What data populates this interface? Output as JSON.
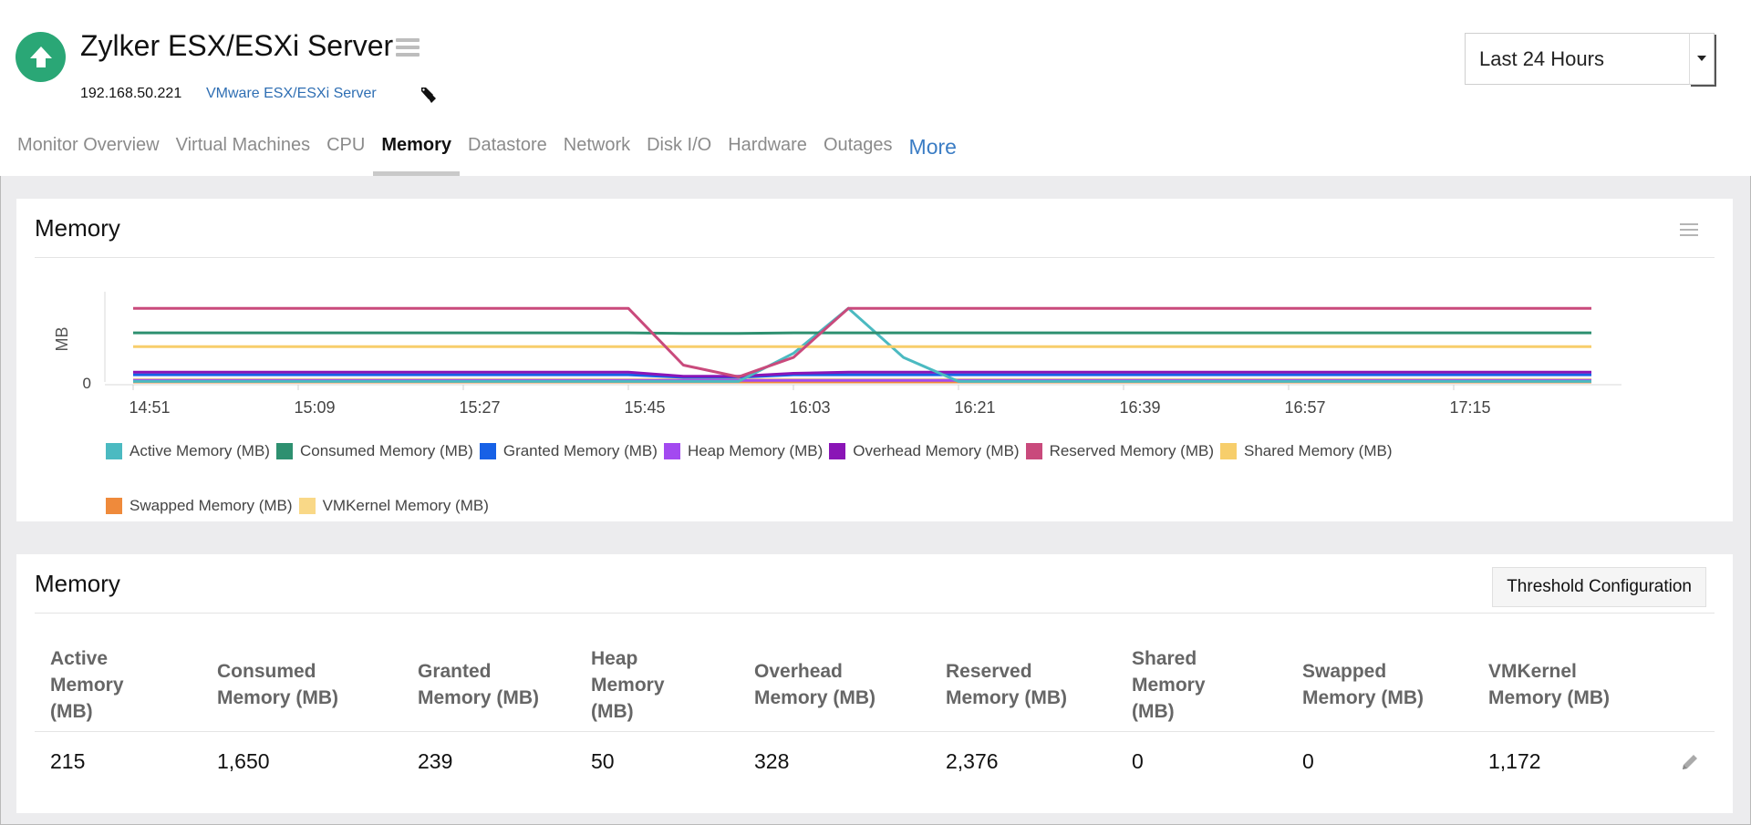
{
  "monitor": {
    "title": "Zylker ESX/ESXi Server",
    "ip": "192.168.50.221",
    "type_link": "VMware ESX/ESXi Server",
    "status_color": "#2aa776"
  },
  "time_range": {
    "selected": "Last 24 Hours"
  },
  "tabs": [
    {
      "label": "Monitor Overview"
    },
    {
      "label": "Virtual Machines"
    },
    {
      "label": "CPU"
    },
    {
      "label": "Memory"
    },
    {
      "label": "Datastore"
    },
    {
      "label": "Network"
    },
    {
      "label": "Disk I/O"
    },
    {
      "label": "Hardware"
    },
    {
      "label": "Outages"
    },
    {
      "label": "More"
    }
  ],
  "active_tab": "Memory",
  "chart_panel": {
    "title": "Memory"
  },
  "chart_data": {
    "type": "line",
    "title": "",
    "xlabel": "",
    "ylabel": "MB",
    "y_tick_labels": [
      "0"
    ],
    "x_tick_labels": [
      "14:51",
      "15:09",
      "15:27",
      "15:45",
      "16:03",
      "16:21",
      "16:39",
      "16:57",
      "17:15"
    ],
    "grid": false,
    "legend_position": "bottom",
    "x": [
      "14:51",
      "15:45",
      "15:51",
      "15:57",
      "16:03",
      "16:09",
      "16:15",
      "16:21",
      "17:35"
    ],
    "ylim": [
      0,
      900
    ],
    "series": [
      {
        "name": "Active Memory (MB)",
        "color": "#4bbac1",
        "values": [
          5,
          5,
          5,
          5,
          280,
          720,
          240,
          5,
          5
        ]
      },
      {
        "name": "Consumed Memory (MB)",
        "color": "#2e9070",
        "values": [
          480,
          480,
          475,
          475,
          480,
          480,
          480,
          480,
          480
        ]
      },
      {
        "name": "Granted Memory (MB)",
        "color": "#1761e6",
        "values": [
          70,
          70,
          45,
          45,
          70,
          70,
          70,
          70,
          70
        ]
      },
      {
        "name": "Heap Memory (MB)",
        "color": "#a34af0",
        "values": [
          15,
          15,
          15,
          15,
          15,
          15,
          15,
          15,
          15
        ]
      },
      {
        "name": "Overhead Memory (MB)",
        "color": "#8a15b6",
        "values": [
          95,
          95,
          55,
          55,
          85,
          95,
          95,
          95,
          95
        ]
      },
      {
        "name": "Reserved Memory (MB)",
        "color": "#c94a7c",
        "values": [
          720,
          720,
          165,
          50,
          240,
          720,
          720,
          720,
          720
        ]
      },
      {
        "name": "Shared Memory (MB)",
        "color": "#f7ce6b",
        "values": [
          345,
          345,
          345,
          345,
          345,
          345,
          345,
          345,
          345
        ]
      },
      {
        "name": "Swapped Memory (MB)",
        "color": "#ef8a3b",
        "values": [
          0,
          0,
          0,
          0,
          0,
          0,
          0,
          0,
          0
        ]
      },
      {
        "name": "VMKernel Memory (MB)",
        "color": "#f9d887",
        "values": [
          25,
          25,
          25,
          25,
          25,
          25,
          25,
          25,
          25
        ]
      }
    ]
  },
  "table_panel": {
    "title": "Memory",
    "threshold_button": "Threshold Configuration",
    "columns": [
      [
        "Active",
        "Memory",
        "(MB)"
      ],
      [
        "Consumed",
        "Memory (MB)"
      ],
      [
        "Granted",
        "Memory (MB)"
      ],
      [
        "Heap",
        "Memory",
        "(MB)"
      ],
      [
        "Overhead",
        "Memory (MB)"
      ],
      [
        "Reserved",
        "Memory (MB)"
      ],
      [
        "Shared",
        "Memory",
        "(MB)"
      ],
      [
        "Swapped",
        "Memory (MB)"
      ],
      [
        "VMKernel",
        "Memory (MB)"
      ]
    ],
    "row": [
      "215",
      "1,650",
      "239",
      "50",
      "328",
      "2,376",
      "0",
      "0",
      "1,172"
    ]
  },
  "icons": {
    "status": "up-arrow-icon",
    "title_menu": "hamburger-menu-icon",
    "tag": "tag-icon",
    "dropdown": "caret-down-icon",
    "panel_menu": "hamburger-menu-icon",
    "edit": "pencil-icon"
  }
}
